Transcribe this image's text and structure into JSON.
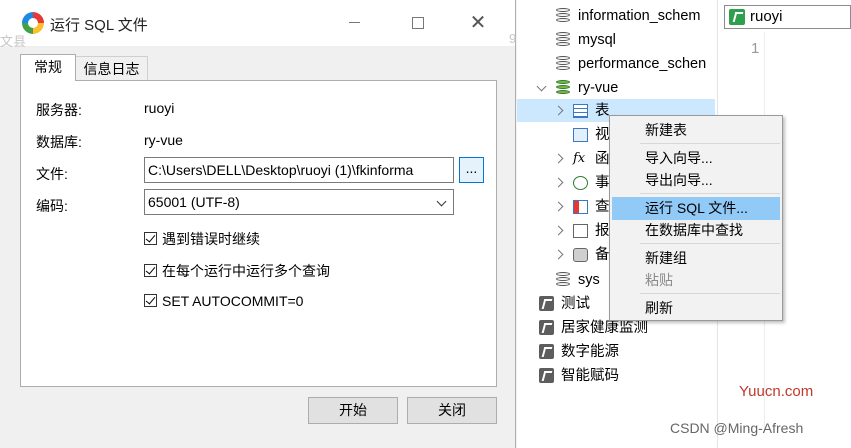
{
  "dialog": {
    "title": "运行 SQL 文件",
    "background_ghost": [
      "文县",
      "9"
    ],
    "tabs": [
      "常规",
      "信息日志"
    ],
    "server_label": "服务器:",
    "server_value": "ruoyi",
    "db_label": "数据库:",
    "db_value": "ry-vue",
    "file_label": "文件:",
    "file_value": "C:\\Users\\DELL\\Desktop\\ruoyi (1)\\fkinforma",
    "browse_label": "...",
    "encoding_label": "编码:",
    "encoding_value": "65001 (UTF-8)",
    "checkboxes": [
      {
        "label": "遇到错误时继续",
        "checked": true
      },
      {
        "label": "在每个运行中运行多个查询",
        "checked": true
      },
      {
        "label": "SET AUTOCOMMIT=0",
        "checked": true
      }
    ],
    "start_button": "开始",
    "close_button": "关闭"
  },
  "tree": {
    "databases": [
      "information_schem",
      "mysql",
      "performance_schen",
      "ry-vue"
    ],
    "children": [
      "表",
      "视",
      "函",
      "事",
      "查",
      "报",
      "备"
    ],
    "sys": "sys",
    "connections": [
      "测试",
      "居家健康监测",
      "数字能源",
      "智能赋码"
    ]
  },
  "editor": {
    "connection_tab": "ruoyi",
    "line_number": "1"
  },
  "context_menu": {
    "items": [
      "新建表",
      "导入向导...",
      "导出向导...",
      "运行 SQL 文件...",
      "在数据库中查找",
      "新建组",
      "粘贴",
      "刷新"
    ],
    "highlighted": "运行 SQL 文件...",
    "disabled": "粘贴"
  },
  "watermarks": {
    "site": "Yuucn.com",
    "csdn": "CSDN @Ming-Afresh"
  },
  "colors": {
    "menu_highlight": "#91c9f7",
    "tree_selection": "#cce8ff",
    "connection_green": "#2e9e4f"
  }
}
